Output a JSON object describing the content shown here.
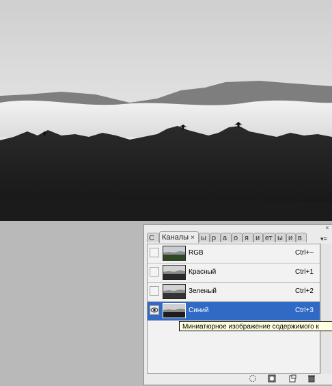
{
  "colors": {
    "selection": "#316ac5",
    "panel_bg": "#ebebeb",
    "tooltip_bg": "#ffffe1",
    "workspace_bg": "#b9b9b9"
  },
  "panel": {
    "close_symbol": "×",
    "menu_symbol": "▾≡",
    "tabs": [
      {
        "label": "С",
        "active": false
      },
      {
        "label": "Каналы",
        "active": true,
        "close": "×"
      },
      {
        "label": "ы",
        "active": false
      },
      {
        "label": "р",
        "active": false
      },
      {
        "label": "а",
        "active": false
      },
      {
        "label": "о",
        "active": false
      },
      {
        "label": "я",
        "active": false
      },
      {
        "label": "и",
        "active": false
      },
      {
        "label": "ет",
        "active": false
      },
      {
        "label": "ы",
        "active": false
      },
      {
        "label": "и",
        "active": false
      },
      {
        "label": "в",
        "active": false
      }
    ],
    "channels": [
      {
        "name": "RGB",
        "shortcut": "Ctrl+~",
        "visible": false,
        "selected": false,
        "thumb": "color"
      },
      {
        "name": "Красный",
        "shortcut": "Ctrl+1",
        "visible": false,
        "selected": false,
        "thumb": "gray"
      },
      {
        "name": "Зеленый",
        "shortcut": "Ctrl+2",
        "visible": false,
        "selected": false,
        "thumb": "gray"
      },
      {
        "name": "Синий",
        "shortcut": "Ctrl+3",
        "visible": true,
        "selected": true,
        "thumb": "gray"
      }
    ],
    "eye_icon": "eye-icon",
    "footer_icons": [
      "load-selection-icon",
      "save-selection-icon",
      "new-channel-icon",
      "trash-icon"
    ]
  },
  "tooltip": {
    "text": "Миниатюрное изображение содержимого к"
  }
}
